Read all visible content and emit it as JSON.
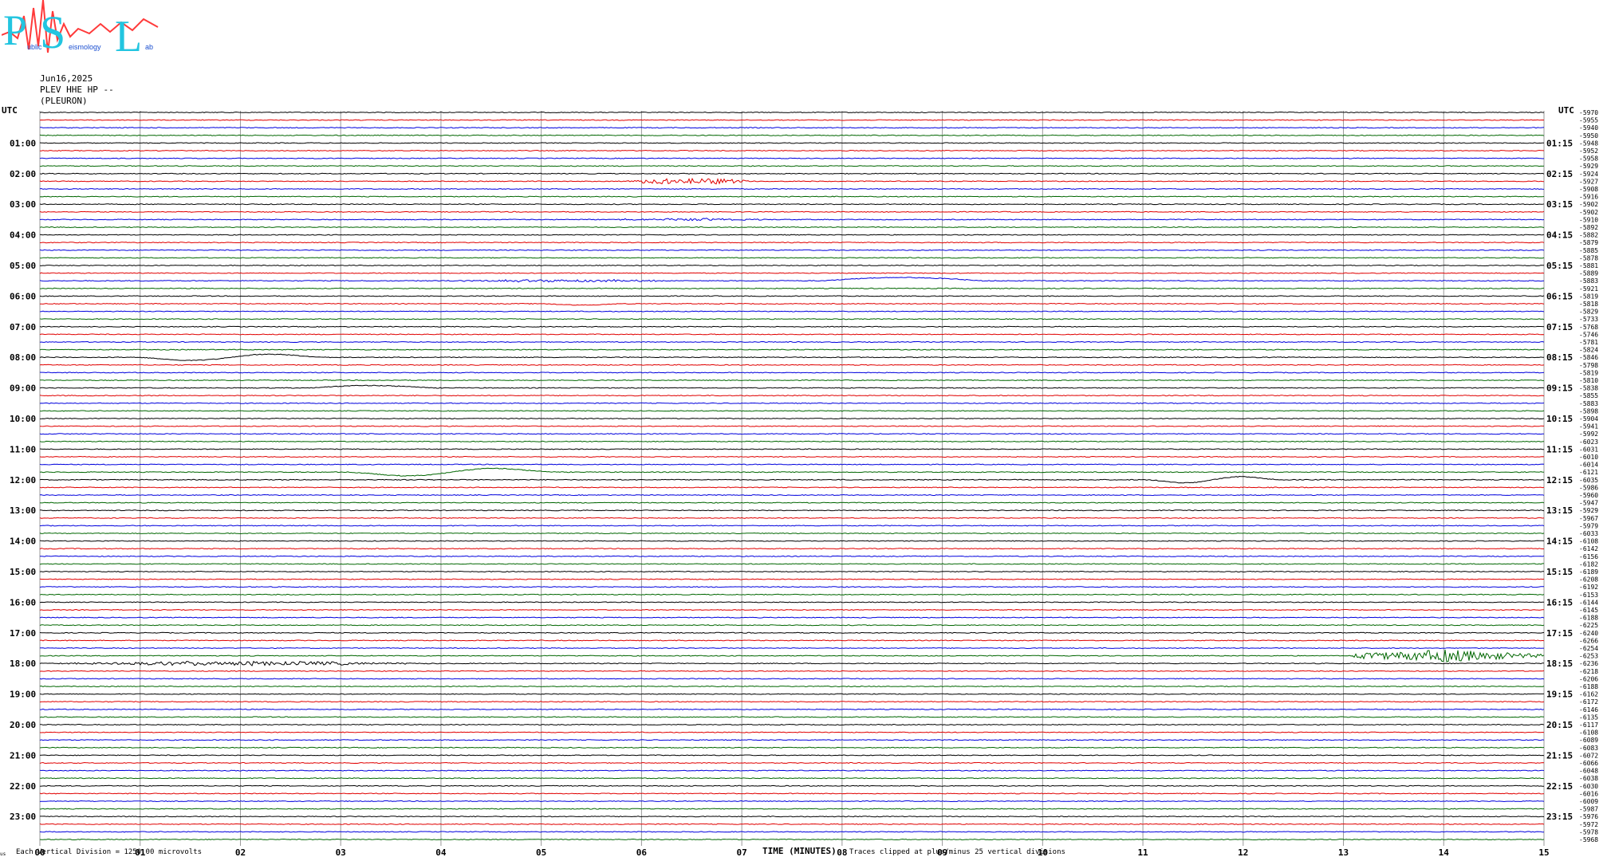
{
  "logo": {
    "letters": [
      "P",
      "S",
      "L"
    ],
    "small_words": [
      "ublic",
      "eismology",
      "ab"
    ],
    "colors": {
      "letters": "#22c5e0",
      "waveform": "#ff3a3a"
    }
  },
  "header": {
    "date": "Jun16,2025",
    "station": "PLEV HHE HP --",
    "site": "(PLEURON)"
  },
  "axis": {
    "left_title": "UTC",
    "right_title": "UTC",
    "left_labels": [
      "01:00",
      "02:00",
      "03:00",
      "04:00",
      "05:00",
      "06:00",
      "07:00",
      "08:00",
      "09:00",
      "10:00",
      "11:00",
      "12:00",
      "13:00",
      "14:00",
      "15:00",
      "16:00",
      "17:00",
      "18:00",
      "19:00",
      "20:00",
      "21:00",
      "22:00",
      "23:00"
    ],
    "right_labels": [
      "01:15",
      "02:15",
      "03:15",
      "04:15",
      "05:15",
      "06:15",
      "07:15",
      "08:15",
      "09:15",
      "10:15",
      "11:15",
      "12:15",
      "13:15",
      "14:15",
      "15:15",
      "16:15",
      "17:15",
      "18:15",
      "19:15",
      "20:15",
      "21:15",
      "22:15",
      "23:15"
    ],
    "xlabel": "TIME (MINUTES)",
    "x_ticks": [
      "00",
      "01",
      "02",
      "03",
      "04",
      "05",
      "06",
      "07",
      "08",
      "09",
      "10",
      "11",
      "12",
      "13",
      "14",
      "15"
    ]
  },
  "footer": {
    "left": "Each Vertical Division = 1250.00 microvolts",
    "right": "Traces clipped at plus/minus 25 vertical divisions",
    "corner": "us"
  },
  "chart_data": {
    "type": "line",
    "title": "",
    "xlabel": "TIME (MINUTES)",
    "ylabel": "UTC",
    "xlim": [
      0,
      15
    ],
    "trace_count": 96,
    "trace_minutes": 15,
    "trace_colors": [
      "#000000",
      "#e00000",
      "#0000dd",
      "#006600"
    ],
    "grid": true,
    "offsets": [
      -5970,
      -5955,
      -5940,
      -5950,
      -5948,
      -5952,
      -5958,
      -5929,
      -5924,
      -5927,
      -5908,
      -5916,
      -5902,
      -5902,
      -5910,
      -5892,
      -5882,
      -5879,
      -5885,
      -5878,
      -5881,
      -5889,
      -5883,
      -5921,
      -5819,
      -5818,
      -5829,
      -5733,
      -5768,
      -5746,
      -5781,
      -5824,
      -5846,
      -5798,
      -5819,
      -5810,
      -5838,
      -5855,
      -5883,
      -5898,
      -5904,
      -5941,
      -5992,
      -6023,
      -6031,
      -6010,
      -6014,
      -6121,
      -6035,
      -5986,
      -5960,
      -5947,
      -5929,
      -5967,
      -5979,
      -6033,
      -6108,
      -6142,
      -6156,
      -6182,
      -6189,
      -6208,
      -6192,
      -6153,
      -6144,
      -6145,
      -6188,
      -6225,
      -6240,
      -6266,
      -6254,
      -6253,
      -6236,
      -6218,
      -6206,
      -6188,
      -6162,
      -6172,
      -6146,
      -6135,
      -6117,
      -6108,
      -6089,
      -6083,
      -6072,
      -6066,
      -6048,
      -6038,
      -6030,
      -6016,
      -6009,
      -5987,
      -5976,
      -5972,
      -5978,
      -5968
    ],
    "events": [
      {
        "trace": 9,
        "start_min": 5.8,
        "end_min": 7.2,
        "amplitude": 4,
        "shape": "burst"
      },
      {
        "trace": 14,
        "start_min": 5.6,
        "end_min": 7.3,
        "amplitude": 1.5,
        "shape": "burst"
      },
      {
        "trace": 22,
        "start_min": 4.0,
        "end_min": 6.5,
        "amplitude": 1.5,
        "shape": "burst"
      },
      {
        "trace": 22,
        "start_min": 7.8,
        "end_min": 9.4,
        "amplitude": -4,
        "shape": "bump"
      },
      {
        "trace": 25,
        "start_min": 5.0,
        "end_min": 5.8,
        "amplitude": 1.5,
        "shape": "bump"
      },
      {
        "trace": 32,
        "start_min": 0.9,
        "end_min": 2.9,
        "amplitude": 5,
        "shape": "swell"
      },
      {
        "trace": 36,
        "start_min": 2.7,
        "end_min": 3.9,
        "amplitude": -3,
        "shape": "bump"
      },
      {
        "trace": 47,
        "start_min": 3.0,
        "end_min": 5.2,
        "amplitude": 6,
        "shape": "swell"
      },
      {
        "trace": 48,
        "start_min": 11.0,
        "end_min": 12.4,
        "amplitude": 5,
        "shape": "swell"
      },
      {
        "trace": 72,
        "start_min": 0.0,
        "end_min": 4.0,
        "amplitude": 2.5,
        "shape": "burst"
      },
      {
        "trace": 71,
        "start_min": 13.1,
        "end_min": 15.0,
        "amplitude": 8,
        "shape": "quake"
      }
    ]
  }
}
